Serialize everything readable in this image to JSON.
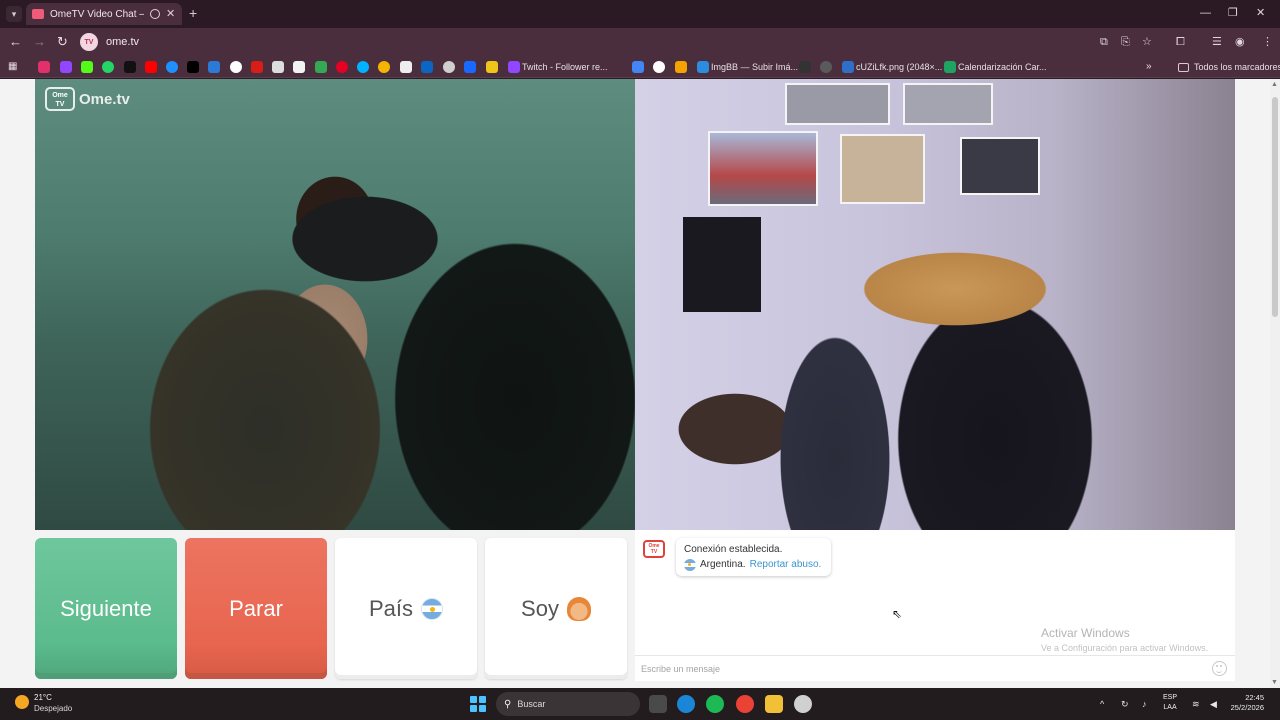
{
  "browser": {
    "tab_title": "OmeTV Video Chat — Omeg",
    "url": "ome.tv",
    "new_tab_symbol": "+",
    "bookmarks": [
      {
        "label": "Twitch - Follower re...",
        "color": "#9146ff"
      },
      {
        "label": "ImgBB — Subir Imá...",
        "color": "#2c8de0"
      },
      {
        "label": "cUZiLfk.png (2048×...",
        "color": "#2f6fc7"
      },
      {
        "label": "Calendarización Car...",
        "color": "#1ea362"
      }
    ],
    "all_bookmarks_label": "Todos los marcadores"
  },
  "logo": {
    "tv_text": "Ome TV",
    "text": "Ome.tv"
  },
  "buttons": {
    "next_label": "Siguiente",
    "stop_label": "Parar",
    "country_label": "País",
    "gender_label": "Soy"
  },
  "chat": {
    "messages": {
      "status": "Conexión establecida.",
      "country": "Argentina.",
      "report_link": "Reportar abuso."
    },
    "input_placeholder": "Escribe un mensaje"
  },
  "watermark": {
    "title": "Activar Windows",
    "subtitle": "Ve a Configuración para activar Windows."
  },
  "taskbar": {
    "weather_temp": "21°C",
    "weather_desc": "Despejado",
    "search_label": "Buscar",
    "lang_line1": "ESP",
    "lang_line2": "LAA",
    "time": "22:45",
    "date": "25/2/2026"
  },
  "colors": {
    "next": "#5bbb8c",
    "stop": "#e8654f",
    "link": "#3a96d1",
    "tab_bg": "#4a2e3e"
  }
}
